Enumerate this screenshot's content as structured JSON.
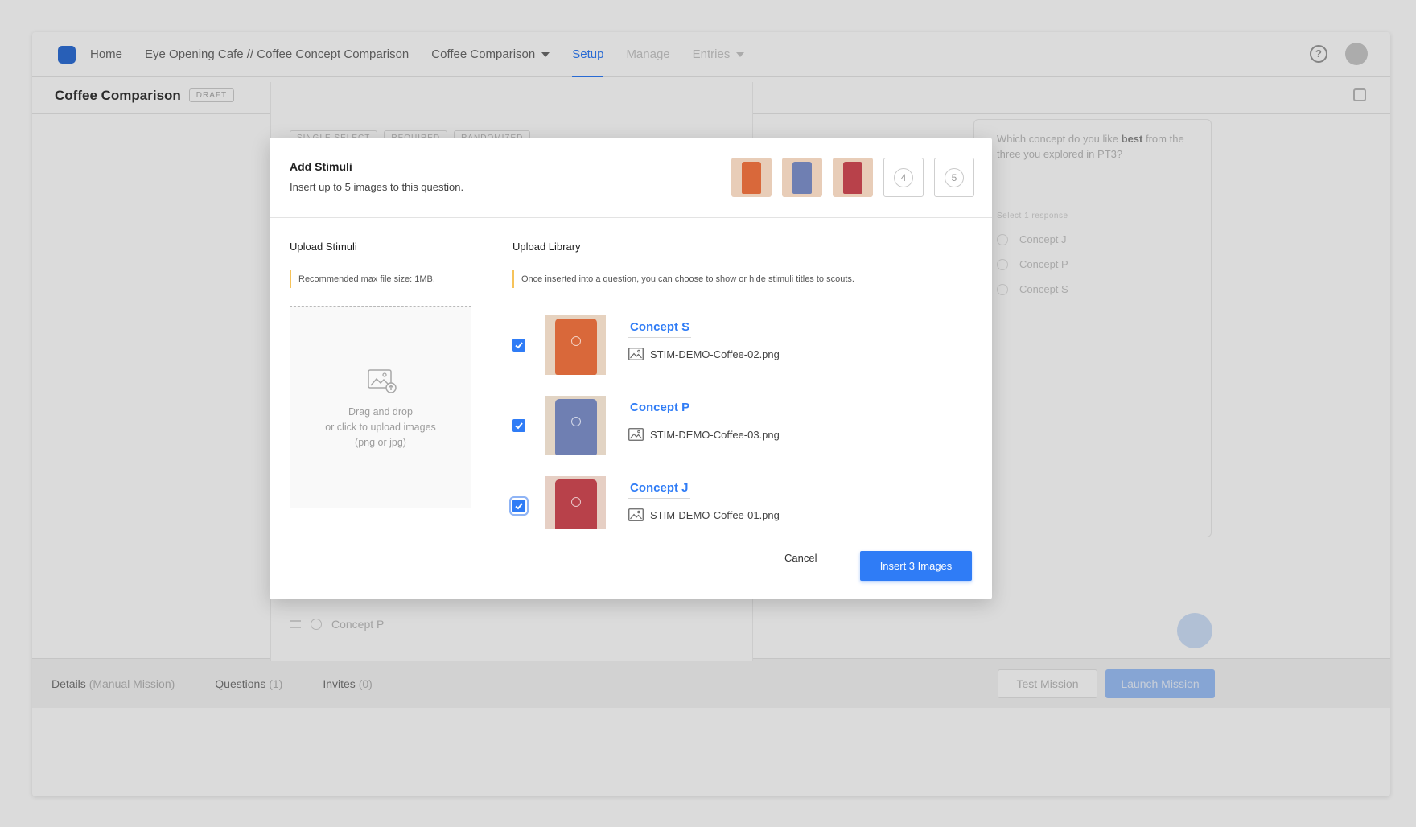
{
  "app": {
    "nav": {
      "home": "Home",
      "breadcrumb": "Eye Opening Cafe // Coffee Concept Comparison",
      "mission_dropdown": "Coffee Comparison",
      "setup": "Setup",
      "manage": "Manage",
      "entries": "Entries"
    },
    "page_title": "Coffee Comparison",
    "status_badge": "DRAFT",
    "tags": [
      "SINGLE SELECT",
      "REQUIRED",
      "RANDOMIZED"
    ],
    "bg_option": "Concept P",
    "preview": {
      "question_pre": "Which concept do you like ",
      "question_bold": "best",
      "question_post": " from the three you explored in PT3?",
      "subtitle": "Select 1 response",
      "options": [
        "Concept J",
        "Concept P",
        "Concept S"
      ]
    },
    "footer": {
      "details_label": "Details",
      "details_count": "(Manual Mission)",
      "questions_label": "Questions",
      "questions_count": "(1)",
      "invites_label": "Invites",
      "invites_count": "(0)",
      "test_mission": "Test Mission",
      "launch_mission": "Launch Mission"
    }
  },
  "modal": {
    "title": "Add Stimuli",
    "subtitle": "Insert up to 5 images to this question.",
    "slots": [
      {
        "state": "filled",
        "color": "#d9683a"
      },
      {
        "state": "filled",
        "color": "#6f7fb2"
      },
      {
        "state": "filled",
        "color": "#b8414a"
      },
      {
        "state": "empty",
        "number": "4"
      },
      {
        "state": "empty",
        "number": "5"
      }
    ],
    "upload": {
      "title": "Upload Stimuli",
      "note": "Recommended max file size: 1MB.",
      "dropzone_line1": "Drag and drop",
      "dropzone_line2": "or click to upload images",
      "dropzone_line3": "(png or jpg)"
    },
    "library": {
      "title": "Upload Library",
      "note": "Once inserted into a question, you can choose to show or hide stimuli titles to scouts.",
      "items": [
        {
          "title": "Concept S",
          "file": "STIM-DEMO-Coffee-02.png",
          "checked": true,
          "color": "#d9683a"
        },
        {
          "title": "Concept P",
          "file": "STIM-DEMO-Coffee-03.png",
          "checked": true,
          "color": "#6f7fb2"
        },
        {
          "title": "Concept J",
          "file": "STIM-DEMO-Coffee-01.png",
          "checked": true,
          "color": "#b8414a"
        }
      ]
    },
    "cancel_label": "Cancel",
    "insert_label": "Insert 3 Images",
    "accent_color": "#2f7cf6"
  }
}
